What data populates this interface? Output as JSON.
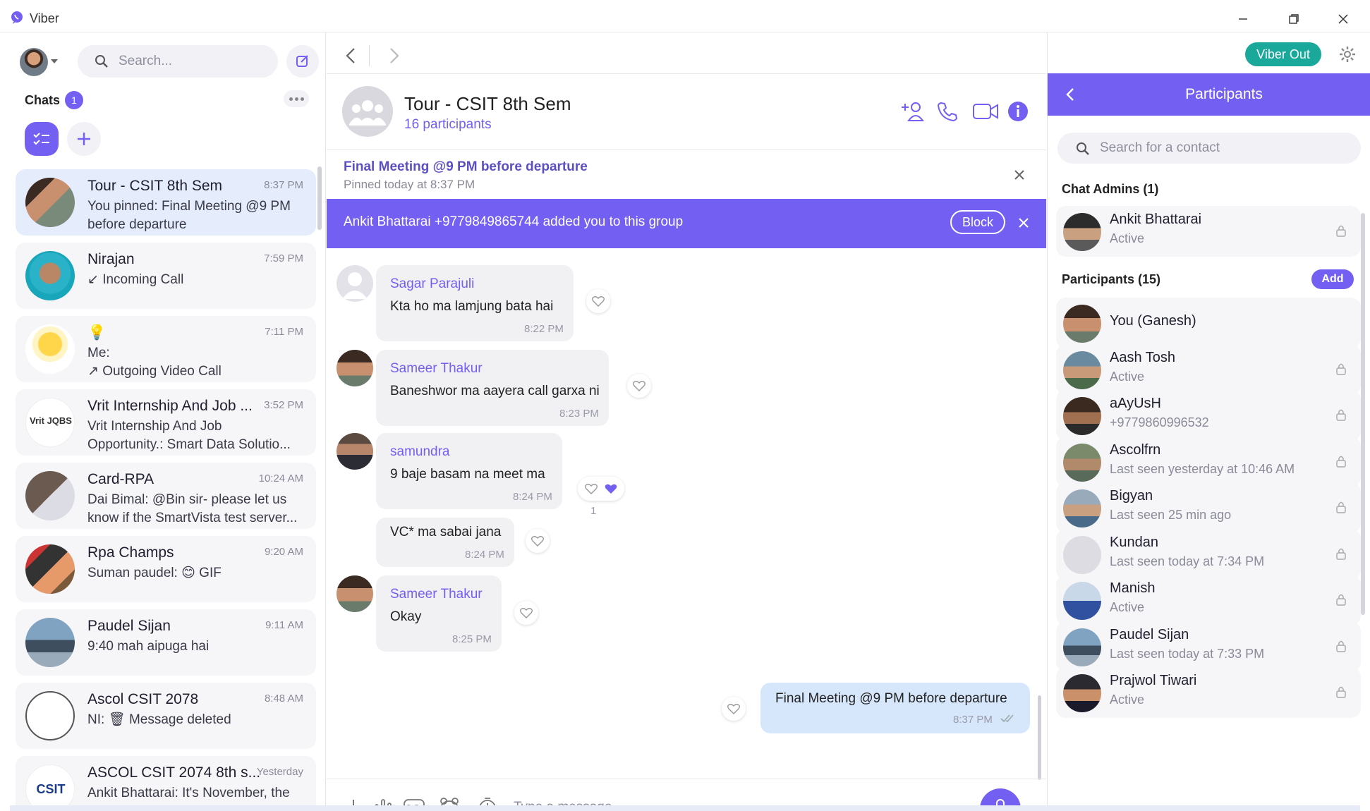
{
  "window": {
    "title": "Viber"
  },
  "left": {
    "search_placeholder": "Search...",
    "chats_label": "Chats",
    "chats_badge": "1",
    "chats": [
      {
        "name": "Tour - CSIT 8th Sem",
        "time": "8:37 PM",
        "preview": "You pinned: Final Meeting @9 PM before departure",
        "active": true
      },
      {
        "name": "Nirajan",
        "time": "7:59 PM",
        "preview": "↙ Incoming Call"
      },
      {
        "name": "💡",
        "time": "7:11 PM",
        "preview": "Me:\n↗ Outgoing Video Call"
      },
      {
        "name": "Vrit Internship And Job ...",
        "time": "3:52 PM",
        "preview": "Vrit Internship And Job Opportunity.: Smart Data Solutio..."
      },
      {
        "name": "Card-RPA",
        "time": "10:24 AM",
        "preview": "Dai Bimal: @Bin sir- please let us know if the SmartVista test server..."
      },
      {
        "name": "Rpa Champs",
        "time": "9:20 AM",
        "preview": "Suman paudel: 😊 GIF"
      },
      {
        "name": "Paudel Sijan",
        "time": "9:11 AM",
        "preview": "9:40 mah aipuga hai"
      },
      {
        "name": "Ascol CSIT 2078",
        "time": "8:48 AM",
        "preview": "NI: 🗑 Message deleted"
      },
      {
        "name": "ASCOL CSIT 2074 8th s...",
        "time": "Yesterday",
        "preview": "Ankit Bhattarai: It's November, the"
      }
    ],
    "vrit_logo_text": "Vrit JQBS",
    "csit_logo_text": "CSIT"
  },
  "conversation": {
    "title": "Tour - CSIT 8th Sem",
    "participants_count": "16 participants",
    "pinned": {
      "title": "Final Meeting @9 PM before departure",
      "sub": "Pinned today at 8:37 PM"
    },
    "banner": {
      "text": "Ankit Bhattarai +9779849865744 added you to this group",
      "block_label": "Block"
    },
    "messages": [
      {
        "sender": "Sagar Parajuli",
        "text": "Kta ho ma lamjung bata hai",
        "time": "8:22 PM"
      },
      {
        "sender": "Sameer Thakur",
        "text": "Baneshwor ma aayera call garxa ni",
        "time": "8:23 PM"
      },
      {
        "sender": "samundra",
        "text": "9 baje basam na meet ma",
        "time": "8:24 PM",
        "reaction_count": "1"
      },
      {
        "sender": "",
        "text": "VC* ma sabai jana",
        "time": "8:24 PM"
      },
      {
        "sender": "Sameer Thakur",
        "text": "Okay",
        "time": "8:25 PM"
      }
    ],
    "own_message": {
      "text": "Final Meeting @9 PM before departure",
      "time": "8:37 PM"
    },
    "composer_placeholder": "Type a message..."
  },
  "right": {
    "viber_out_label": "Viber Out",
    "panel_title": "Participants",
    "search_placeholder": "Search for a contact",
    "admins_label": "Chat Admins (1)",
    "participants_label": "Participants (15)",
    "add_label": "Add",
    "admins": [
      {
        "name": "Ankit Bhattarai",
        "status": "Active"
      }
    ],
    "participants": [
      {
        "name": "You (Ganesh)",
        "status": ""
      },
      {
        "name": "Aash Tosh",
        "status": "Active"
      },
      {
        "name": "aAyUsH",
        "status": "+9779860996532"
      },
      {
        "name": "Ascolfrn",
        "status": "Last seen yesterday at 10:46 AM"
      },
      {
        "name": "Bigyan",
        "status": "Last seen 25 min ago"
      },
      {
        "name": "Kundan",
        "status": "Last seen today at 7:34 PM"
      },
      {
        "name": "Manish",
        "status": "Active"
      },
      {
        "name": "Paudel Sijan",
        "status": "Last seen today at 7:33 PM"
      },
      {
        "name": "Prajwol Tiwari",
        "status": "Active"
      }
    ]
  },
  "colors": {
    "accent": "#7360f2",
    "viber_out": "#1aa89b",
    "own_bubble": "#d7e7fb"
  }
}
